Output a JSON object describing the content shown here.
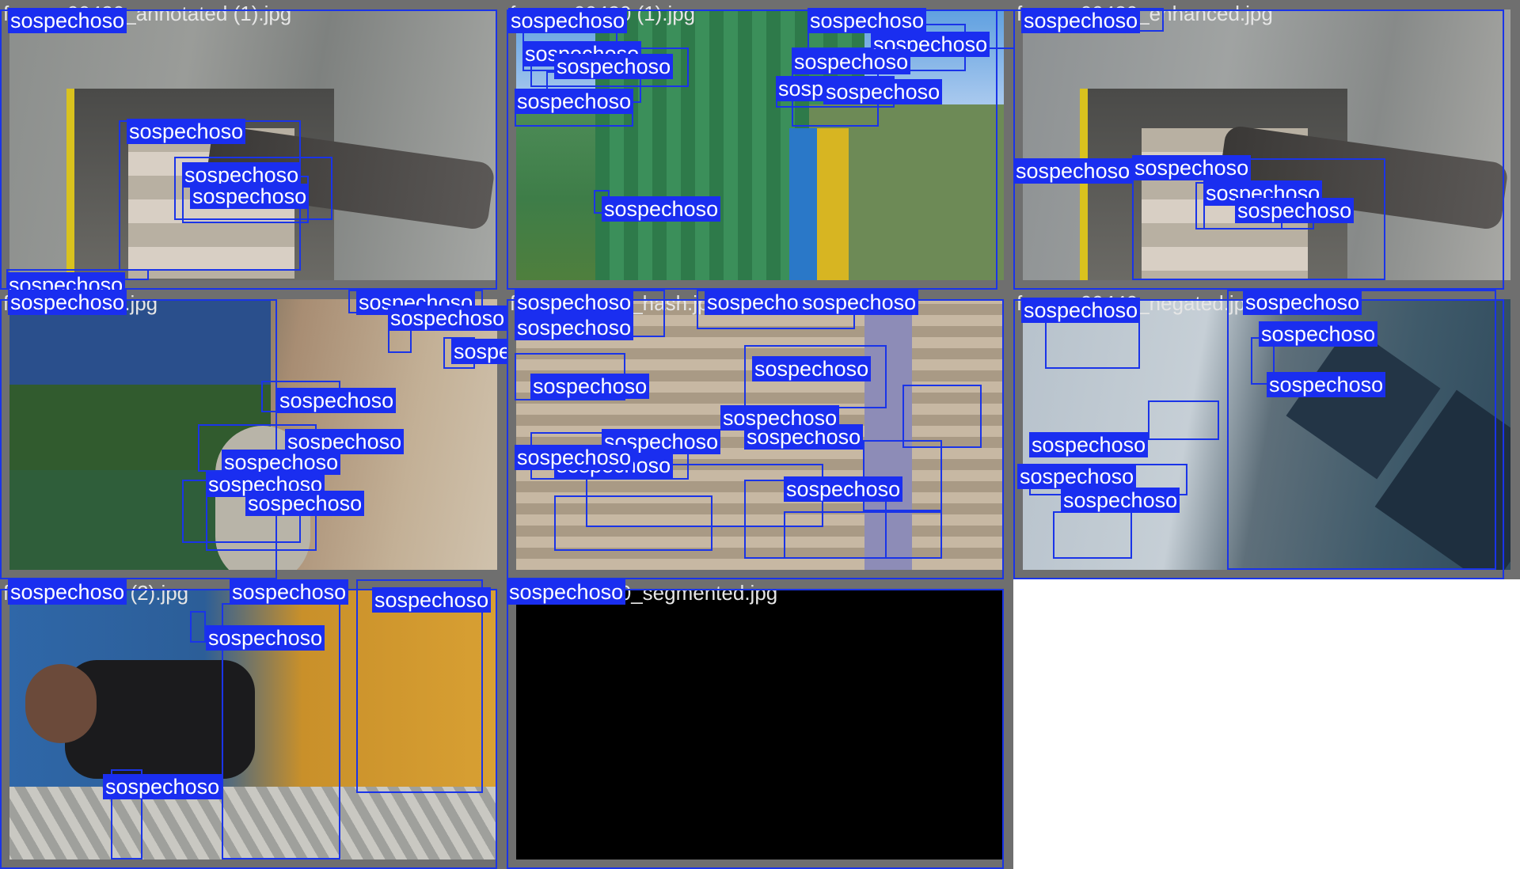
{
  "mosaic": {
    "box_color": "#1a34e8",
    "label_color": "#1a2ef0",
    "images": [
      {
        "filename": "frame_00420_annotated (1).jpg",
        "scene": "s1",
        "labels": [
          "sospechoso",
          "sospechoso",
          "sospechoso",
          "sospechoso",
          "sospechoso"
        ]
      },
      {
        "filename": "frame_00420 (1).jpg",
        "scene": "s2",
        "labels": [
          "sospechoso",
          "sospechoso",
          "sospechoso",
          "sospechoso",
          "sospechoso",
          "sospechoso",
          "sospechoso",
          "sospechoso",
          "sospechoso",
          "sospechoso"
        ]
      },
      {
        "filename": "frame_00420_enhanced.jpg",
        "scene": "s3",
        "labels": [
          "sospechoso",
          "sospechoso",
          "sospechoso",
          "sospechoso",
          "sospechoso"
        ]
      },
      {
        "filename": "frame_00430.jpg",
        "scene": "s4",
        "labels": [
          "sospechoso",
          "sospechoso",
          "sospechoso",
          "sospechoso",
          "sospechoso",
          "sospechoso",
          "sospechoso",
          "sospechoso",
          "sospechoso"
        ]
      },
      {
        "filename": "frame_00430_hash.jpg",
        "scene": "s5",
        "labels": [
          "sospechoso",
          "sospechoso",
          "sospechoso",
          "sospechoso",
          "sospechoso",
          "sospechoso",
          "sospechoso",
          "sospechoso",
          "sospechoso",
          "sospechoso",
          "sospechoso",
          "sospechoso"
        ]
      },
      {
        "filename": "frame_00440_negated.jpg",
        "scene": "s6",
        "labels": [
          "sospechoso",
          "sospechoso",
          "sospechoso",
          "sospechoso",
          "sospechoso",
          "sospechoso",
          "sospechoso"
        ]
      },
      {
        "filename": "frame_00430 (2).jpg",
        "scene": "s7",
        "labels": [
          "sospechoso",
          "sospechoso",
          "sospechoso",
          "sospechoso",
          "sospechoso"
        ]
      },
      {
        "filename": "frame_00420_segmented.jpg",
        "scene": "s8",
        "labels": [
          "sospechoso"
        ]
      }
    ]
  }
}
